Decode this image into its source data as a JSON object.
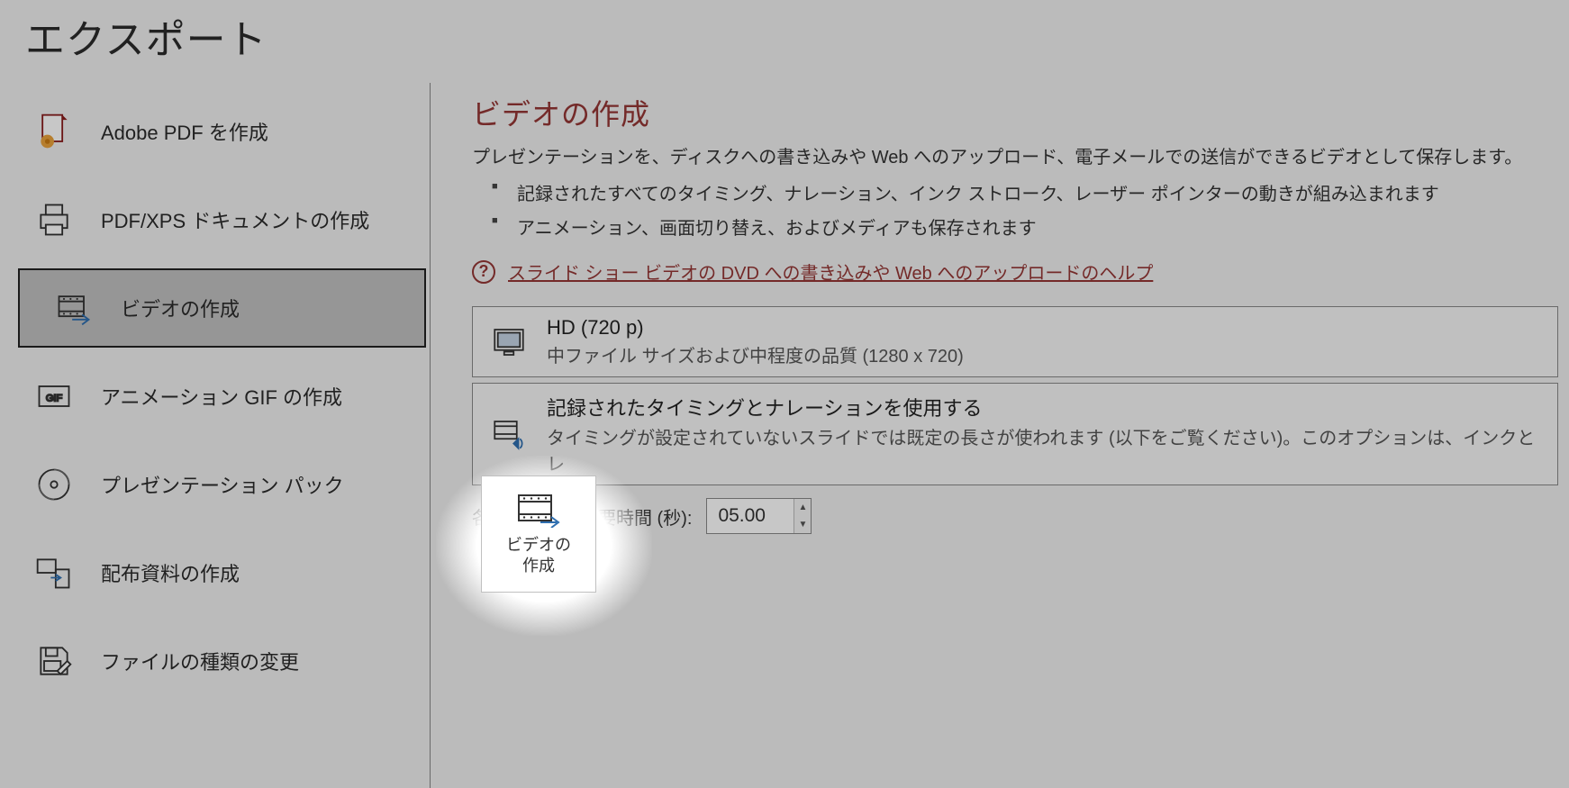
{
  "page_title": "エクスポート",
  "sidebar": {
    "items": [
      {
        "label": "Adobe PDF を作成"
      },
      {
        "label": "PDF/XPS ドキュメントの作成"
      },
      {
        "label": "ビデオの作成"
      },
      {
        "label": "アニメーション GIF の作成"
      },
      {
        "label": "プレゼンテーション パック"
      },
      {
        "label": "配布資料の作成"
      },
      {
        "label": "ファイルの種類の変更"
      }
    ],
    "selected_index": 2
  },
  "main": {
    "title": "ビデオの作成",
    "description": "プレゼンテーションを、ディスクへの書き込みや Web へのアップロード、電子メールでの送信ができるビデオとして保存します。",
    "bullets": [
      "記録されたすべてのタイミング、ナレーション、インク ストローク、レーザー ポインターの動きが組み込まれます",
      "アニメーション、画面切り替え、およびメディアも保存されます"
    ],
    "help_icon_glyph": "?",
    "help_link": "スライド ショー ビデオの DVD への書き込みや Web へのアップロードのヘルプ",
    "quality": {
      "title": "HD (720 p)",
      "sub": "中ファイル サイズおよび中程度の品質 (1280 x 720)"
    },
    "timings": {
      "title": "記録されたタイミングとナレーションを使用する",
      "sub": "タイミングが設定されていないスライドでは既定の長さが使われます (以下をご覧ください)。このオプションは、インクとレ"
    },
    "duration_label": "各スライドの所要時間 (秒):",
    "duration_value": "05.00",
    "button_label": "ビデオの\n作成"
  },
  "colors": {
    "accent": "#953735"
  }
}
